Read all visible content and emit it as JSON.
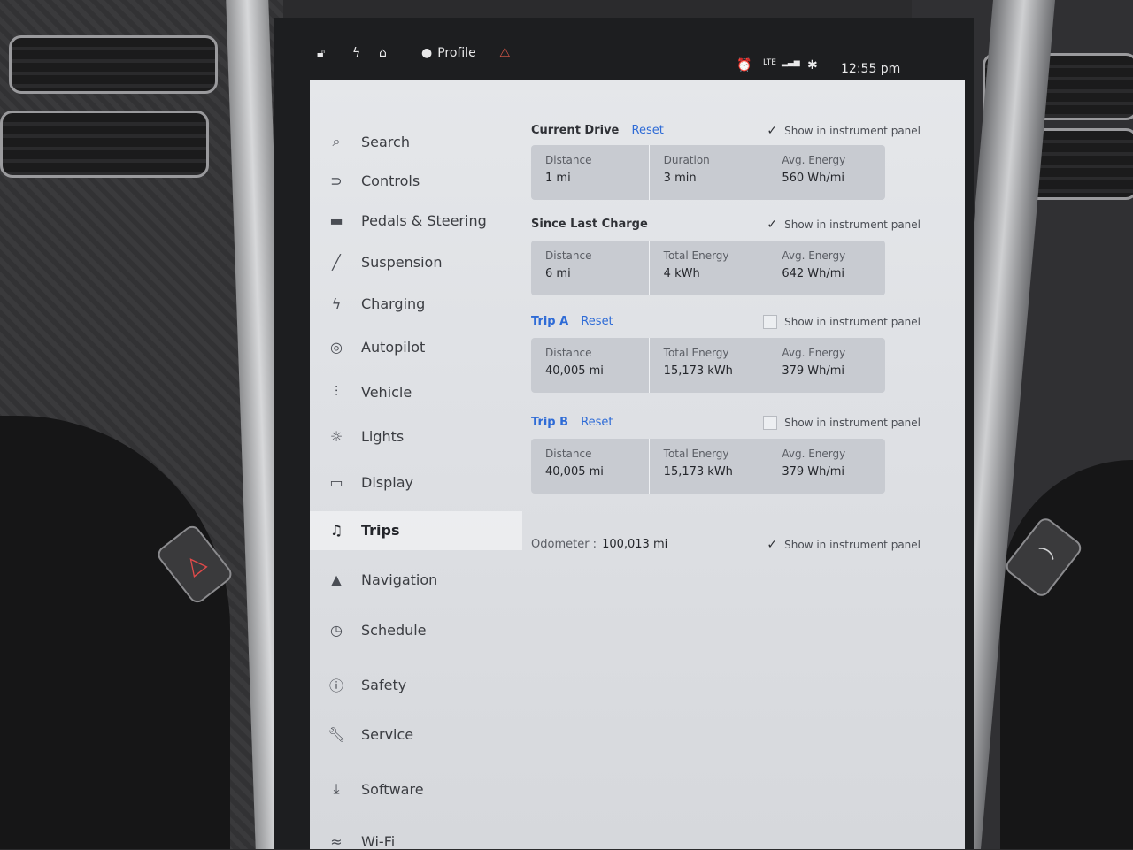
{
  "statusbar": {
    "profile_label": "Profile",
    "time": "12:55 pm",
    "signal": "LTE"
  },
  "sidebar": {
    "items": [
      {
        "label": "Search",
        "icon": "search-icon"
      },
      {
        "label": "Controls",
        "icon": "toggle-icon"
      },
      {
        "label": "Pedals & Steering",
        "icon": "car-icon"
      },
      {
        "label": "Suspension",
        "icon": "wrench-icon"
      },
      {
        "label": "Charging",
        "icon": "bolt-icon"
      },
      {
        "label": "Autopilot",
        "icon": "steering-wheel-icon"
      },
      {
        "label": "Vehicle",
        "icon": "sliders-icon"
      },
      {
        "label": "Lights",
        "icon": "sun-icon"
      },
      {
        "label": "Display",
        "icon": "display-icon"
      },
      {
        "label": "Trips",
        "icon": "trips-icon"
      },
      {
        "label": "Navigation",
        "icon": "navigation-arrow-icon"
      },
      {
        "label": "Schedule",
        "icon": "clock-icon"
      },
      {
        "label": "Safety",
        "icon": "alert-circle-icon"
      },
      {
        "label": "Service",
        "icon": "wrench-icon"
      },
      {
        "label": "Software",
        "icon": "download-icon"
      },
      {
        "label": "Wi-Fi",
        "icon": "wifi-icon"
      }
    ],
    "active": "Trips"
  },
  "trips": {
    "current_drive": {
      "title": "Current Drive",
      "reset": "Reset",
      "show_label": "Show in instrument panel",
      "checked": true,
      "stats": [
        {
          "label": "Distance",
          "value": "1 mi"
        },
        {
          "label": "Duration",
          "value": "3 min"
        },
        {
          "label": "Avg. Energy",
          "value": "560 Wh/mi"
        }
      ]
    },
    "since_last_charge": {
      "title": "Since Last Charge",
      "show_label": "Show in instrument panel",
      "checked": true,
      "stats": [
        {
          "label": "Distance",
          "value": "6 mi"
        },
        {
          "label": "Total Energy",
          "value": "4 kWh"
        },
        {
          "label": "Avg. Energy",
          "value": "642 Wh/mi"
        }
      ]
    },
    "trip_a": {
      "title": "Trip A",
      "reset": "Reset",
      "show_label": "Show in instrument panel",
      "checked": false,
      "stats": [
        {
          "label": "Distance",
          "value": "40,005 mi"
        },
        {
          "label": "Total Energy",
          "value": "15,173 kWh"
        },
        {
          "label": "Avg. Energy",
          "value": "379 Wh/mi"
        }
      ]
    },
    "trip_b": {
      "title": "Trip B",
      "reset": "Reset",
      "show_label": "Show in instrument panel",
      "checked": false,
      "stats": [
        {
          "label": "Distance",
          "value": "40,005 mi"
        },
        {
          "label": "Total Energy",
          "value": "15,173 kWh"
        },
        {
          "label": "Avg. Energy",
          "value": "379 Wh/mi"
        }
      ]
    },
    "odometer": {
      "label": "Odometer :",
      "value": "100,013 mi",
      "show_label": "Show in instrument panel",
      "checked": true
    }
  },
  "colors": {
    "accent": "#2e6bd6",
    "panel": "#e2e4e8",
    "card": "#c8cbd1"
  }
}
